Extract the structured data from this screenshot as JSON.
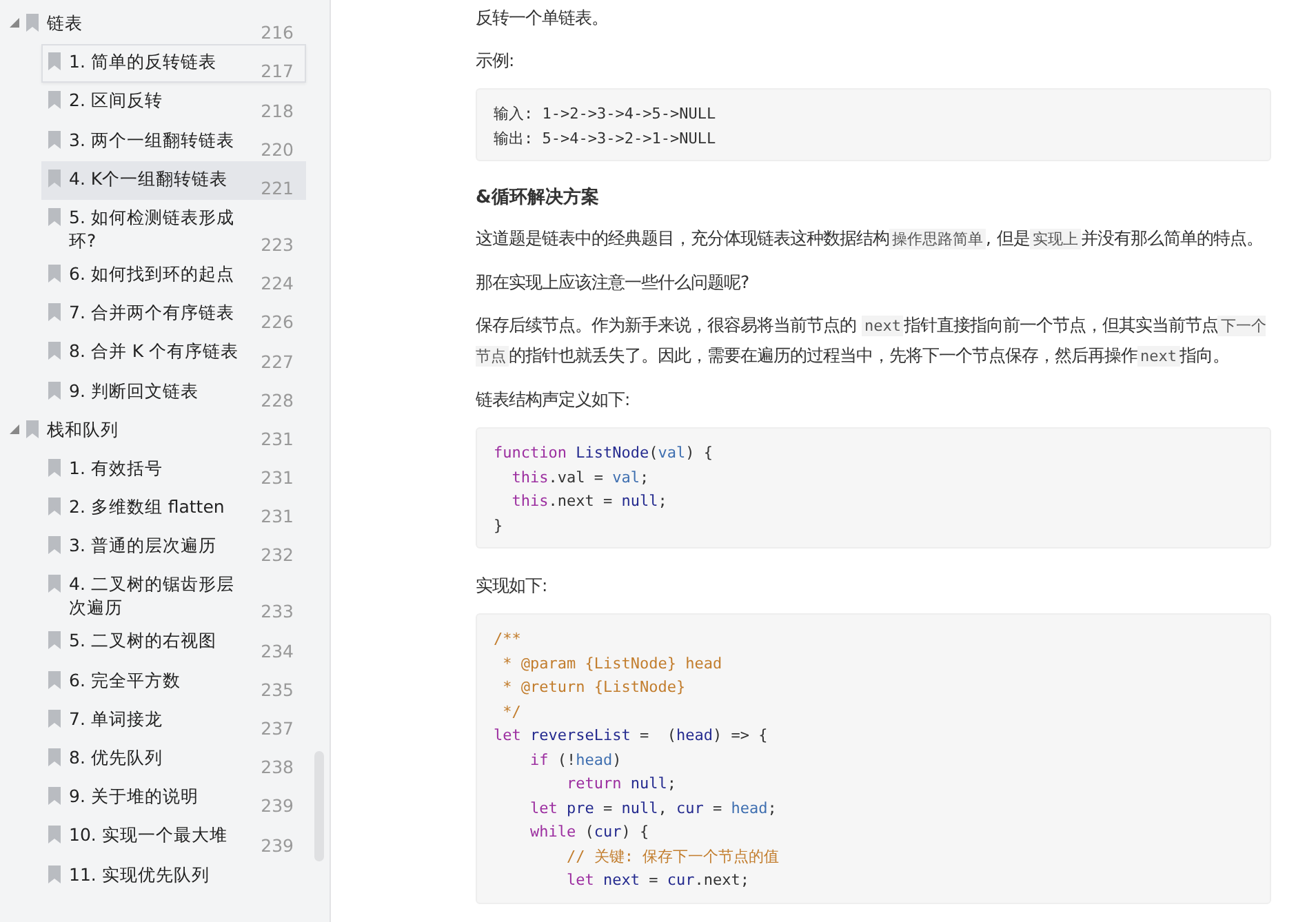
{
  "outline": [
    {
      "label": "链表",
      "page": "216",
      "expanded": true,
      "children": [
        {
          "label": "1. 简单的反转链表",
          "page": "217",
          "selected": false,
          "focused": true
        },
        {
          "label": "2. 区间反转",
          "page": "218",
          "selected": false,
          "focused": false
        },
        {
          "label": "3. 两个一组翻转链表",
          "page": "220",
          "selected": false,
          "focused": false
        },
        {
          "label": "4. K个一组翻转链表",
          "page": "221",
          "selected": true,
          "focused": false
        },
        {
          "label": "5. 如何检测链表形成环?",
          "page": "223",
          "selected": false,
          "focused": false
        },
        {
          "label": "6. 如何找到环的起点",
          "page": "224",
          "selected": false,
          "focused": false
        },
        {
          "label": "7. 合并两个有序链表",
          "page": "226",
          "selected": false,
          "focused": false
        },
        {
          "label": "8. 合并 K 个有序链表",
          "page": "227",
          "selected": false,
          "focused": false
        },
        {
          "label": "9. 判断回文链表",
          "page": "228",
          "selected": false,
          "focused": false
        }
      ]
    },
    {
      "label": "栈和队列",
      "page": "231",
      "expanded": true,
      "children": [
        {
          "label": "1. 有效括号",
          "page": "231",
          "selected": false,
          "focused": false
        },
        {
          "label": "2. 多维数组 flatten",
          "page": "231",
          "selected": false,
          "focused": false
        },
        {
          "label": "3. 普通的层次遍历",
          "page": "232",
          "selected": false,
          "focused": false
        },
        {
          "label": "4. 二叉树的锯齿形层次遍历",
          "page": "233",
          "selected": false,
          "focused": false
        },
        {
          "label": "5. 二叉树的右视图",
          "page": "234",
          "selected": false,
          "focused": false
        },
        {
          "label": "6. 完全平方数",
          "page": "235",
          "selected": false,
          "focused": false
        },
        {
          "label": "7. 单词接龙",
          "page": "237",
          "selected": false,
          "focused": false
        },
        {
          "label": "8. 优先队列",
          "page": "238",
          "selected": false,
          "focused": false
        },
        {
          "label": "9. 关于堆的说明",
          "page": "239",
          "selected": false,
          "focused": false
        },
        {
          "label": "10. 实现一个最大堆",
          "page": "239",
          "selected": false,
          "focused": false
        },
        {
          "label": "11. 实现优先队列",
          "selected": false,
          "focused": false
        }
      ]
    }
  ],
  "article": [
    {
      "kind": "para",
      "segments": [
        {
          "kind": "text",
          "text": "反转一个单链表。"
        }
      ]
    },
    {
      "kind": "para",
      "segments": [
        {
          "kind": "text",
          "text": "示例:"
        }
      ]
    },
    {
      "kind": "code",
      "lines": [
        [
          {
            "kind": "plain",
            "text": "输入: 1->2->3->4->5->NULL"
          }
        ],
        [
          {
            "kind": "plain",
            "text": "输出: 5->4->3->2->1->NULL"
          }
        ]
      ]
    },
    {
      "kind": "heading",
      "segments": [
        {
          "kind": "text",
          "text": "&循环解决方案"
        }
      ]
    },
    {
      "kind": "para",
      "segments": [
        {
          "kind": "text",
          "text": "这道题是链表中的经典题目，充分体现链表这种数据结构"
        },
        {
          "kind": "code",
          "text": "操作思路简单"
        },
        {
          "kind": "text",
          "text": ", 但是"
        },
        {
          "kind": "code",
          "text": "实现上"
        },
        {
          "kind": "text",
          "text": "并没有那么简单的特点。"
        }
      ]
    },
    {
      "kind": "para",
      "segments": [
        {
          "kind": "text",
          "text": "那在实现上应该注意一些什么问题呢?"
        }
      ]
    },
    {
      "kind": "para",
      "segments": [
        {
          "kind": "text",
          "text": "保存后续节点。作为新手来说，很容易将当前节点的 "
        },
        {
          "kind": "code",
          "text": "next"
        },
        {
          "kind": "text",
          "text": "指针直接指向前一个节点，但其实当前节点"
        },
        {
          "kind": "code",
          "text": "下一个节点"
        },
        {
          "kind": "text",
          "text": "的指针也就丢失了。因此，需要在遍历的过程当中，先将下一个节点保存，然后再操作"
        },
        {
          "kind": "code",
          "text": "next"
        },
        {
          "kind": "text",
          "text": "指向。"
        }
      ]
    },
    {
      "kind": "para",
      "segments": [
        {
          "kind": "text",
          "text": "链表结构声定义如下:"
        }
      ]
    },
    {
      "kind": "code",
      "lines": [
        [
          {
            "kind": "keyword",
            "text": "function "
          },
          {
            "kind": "name",
            "text": "ListNode"
          },
          {
            "kind": "plain",
            "text": "("
          },
          {
            "kind": "var",
            "text": "val"
          },
          {
            "kind": "plain",
            "text": ") {"
          }
        ],
        [
          {
            "kind": "keyword",
            "text": "  this"
          },
          {
            "kind": "plain",
            "text": ".val = "
          },
          {
            "kind": "var",
            "text": "val"
          },
          {
            "kind": "plain",
            "text": ";"
          }
        ],
        [
          {
            "kind": "keyword",
            "text": "  this"
          },
          {
            "kind": "plain",
            "text": ".next = "
          },
          {
            "kind": "name",
            "text": "null"
          },
          {
            "kind": "plain",
            "text": ";"
          }
        ],
        [
          {
            "kind": "plain",
            "text": "}"
          }
        ]
      ]
    },
    {
      "kind": "para",
      "segments": [
        {
          "kind": "text",
          "text": "实现如下:"
        }
      ]
    },
    {
      "kind": "code",
      "lines": [
        [
          {
            "kind": "comment",
            "text": "/**"
          }
        ],
        [
          {
            "kind": "comment",
            "text": " * @param {ListNode} head"
          }
        ],
        [
          {
            "kind": "comment",
            "text": " * @return {ListNode}"
          }
        ],
        [
          {
            "kind": "comment",
            "text": " */"
          }
        ],
        [
          {
            "kind": "keyword",
            "text": "let "
          },
          {
            "kind": "name",
            "text": "reverseList"
          },
          {
            "kind": "plain",
            "text": " =  ("
          },
          {
            "kind": "name",
            "text": "head"
          },
          {
            "kind": "plain",
            "text": ") => {"
          }
        ],
        [
          {
            "kind": "keyword",
            "text": "    if"
          },
          {
            "kind": "plain",
            "text": " (!"
          },
          {
            "kind": "var",
            "text": "head"
          },
          {
            "kind": "plain",
            "text": ")"
          }
        ],
        [
          {
            "kind": "keyword",
            "text": "        return "
          },
          {
            "kind": "name",
            "text": "null"
          },
          {
            "kind": "plain",
            "text": ";"
          }
        ],
        [
          {
            "kind": "keyword",
            "text": "    let "
          },
          {
            "kind": "name",
            "text": "pre"
          },
          {
            "kind": "plain",
            "text": " = "
          },
          {
            "kind": "name",
            "text": "null"
          },
          {
            "kind": "plain",
            "text": ", "
          },
          {
            "kind": "name",
            "text": "cur"
          },
          {
            "kind": "plain",
            "text": " = "
          },
          {
            "kind": "var",
            "text": "head"
          },
          {
            "kind": "plain",
            "text": ";"
          }
        ],
        [
          {
            "kind": "keyword",
            "text": "    while"
          },
          {
            "kind": "plain",
            "text": " ("
          },
          {
            "kind": "name",
            "text": "cur"
          },
          {
            "kind": "plain",
            "text": ") {"
          }
        ],
        [
          {
            "kind": "comment",
            "text": "        // 关键: 保存下一个节点的值"
          }
        ],
        [
          {
            "kind": "keyword",
            "text": "        let "
          },
          {
            "kind": "name",
            "text": "next"
          },
          {
            "kind": "plain",
            "text": " = "
          },
          {
            "kind": "name",
            "text": "cur"
          },
          {
            "kind": "plain",
            "text": ".next;"
          }
        ]
      ]
    }
  ]
}
